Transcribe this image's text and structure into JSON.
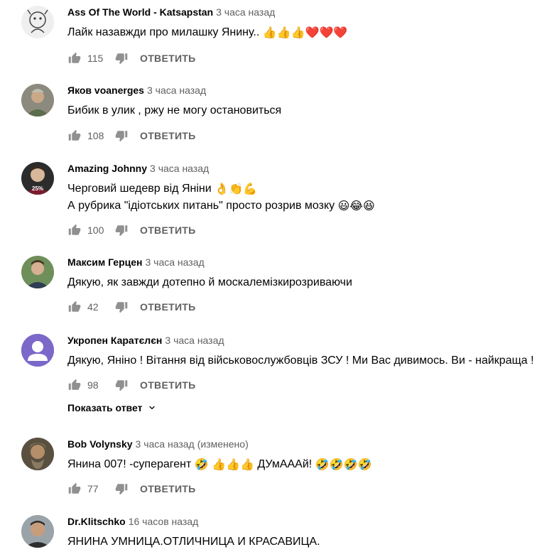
{
  "comments": [
    {
      "author": "Ass Of The World - Katsapstan",
      "time": "3 часа назад",
      "text": "Лайк назавжди про милашку Янину.. ",
      "emoji": "👍👍👍❤️❤️❤️",
      "likes": "115",
      "reply_label": "ОТВЕТИТЬ"
    },
    {
      "author": "Яков voanerges",
      "time": "3 часа назад",
      "text": "Бибик в улик , ржу не могу остановиться",
      "likes": "108",
      "reply_label": "ОТВЕТИТЬ"
    },
    {
      "author": "Amazing Johnny",
      "time": "3 часа назад",
      "text_line1": "Черговий шедевр від Яніни ",
      "emoji_line1": "👌👏💪",
      "text_line2": "А рубрика \"ідіотських питань\"  просто розрив мозку ",
      "emoji_line2": "😃😂😆",
      "avatar_badge": "25%",
      "likes": "100",
      "reply_label": "ОТВЕТИТЬ"
    },
    {
      "author": "Максим Герцен",
      "time": "3 часа назад",
      "text": "Дякую, як завжди дотепно й москалемізкирозриваючи",
      "likes": "42",
      "reply_label": "ОТВЕТИТЬ"
    },
    {
      "author": "Укропен Каратєлєн",
      "time": "3 часа назад",
      "text": "Дякую, Яніно ! Вітання від військовослужбовців ЗСУ ! Ми Вас дивимось. Ви - найкраща !",
      "likes": "98",
      "reply_label": "ОТВЕТИТЬ",
      "show_replies": "Показать ответ"
    },
    {
      "author": "Bob Volynsky",
      "time": "3 часа назад",
      "edited": "(изменено)",
      "text_a": "Янина 007! -суперагент ",
      "emoji_a": "🤣 👍👍👍",
      "text_b": "  ДУмАААй! ",
      "emoji_b": "🤣🤣🤣🤣",
      "likes": "77",
      "reply_label": "ОТВЕТИТЬ"
    },
    {
      "author": "Dr.Klitschko",
      "time": "16 часов назад",
      "text": "ЯНИНА УМНИЦА.ОТЛИЧНИЦА И КРАСАВИЦА."
    }
  ],
  "colors": {
    "text": "#030303",
    "secondary": "#606060",
    "icon": "#909090",
    "default_avatar": "#7b68c9"
  }
}
